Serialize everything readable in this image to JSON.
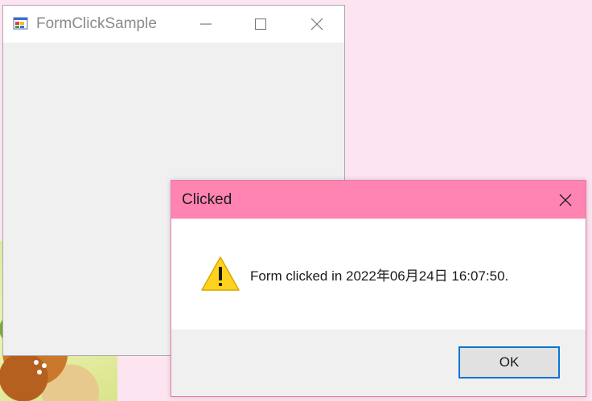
{
  "form_window": {
    "title": "FormClickSample",
    "icon": "winforms-app-icon",
    "controls": [
      "minimize",
      "maximize",
      "close"
    ]
  },
  "message_box": {
    "title": "Clicked",
    "icon": "warning-icon",
    "message": "Form clicked in 2022年06月24日 16:07:50.",
    "ok_label": "OK",
    "title_color": "#ff84b2"
  },
  "colors": {
    "desktop": "#fce4f0",
    "form_client": "#f0f0f0",
    "ok_border": "#0a74d6"
  }
}
